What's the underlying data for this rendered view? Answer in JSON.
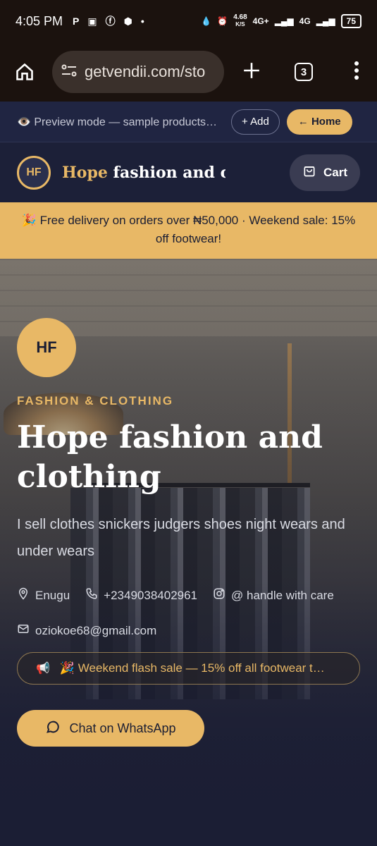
{
  "status_bar": {
    "time": "4:05 PM",
    "net_speed_value": "4.68",
    "net_speed_unit": "K/S",
    "signal_1": "4G+",
    "signal_2": "4G",
    "battery": "75"
  },
  "browser": {
    "url": "getvendii.com/sto",
    "tab_count": "3"
  },
  "preview_bar": {
    "text": "👁️ Preview mode — sample products…",
    "add_label": "+ Add",
    "home_label": "← Home"
  },
  "store_header": {
    "logo_initials": "HF",
    "name_accent": "Hope",
    "name_rest": " fashion and clo",
    "cart_label": "Cart"
  },
  "promo": {
    "text": "🎉 Free delivery on orders over ₦50,000 · Weekend sale: 15% off footwear!"
  },
  "hero": {
    "logo_initials": "HF",
    "category": "FASHION & CLOTHING",
    "title": "Hope fashion and clothing",
    "description": "I sell clothes snickers judgers shoes night wears and under wears",
    "location": "Enugu",
    "phone": "+2349038402961",
    "instagram": "@ handle with care",
    "email": "oziokoe68@gmail.com",
    "flash_text": "🎉 Weekend flash sale — 15% off all footwear t…",
    "whatsapp_label": "Chat on WhatsApp"
  },
  "colors": {
    "accent": "#e8b866",
    "navy": "#1c2038",
    "browser_bg": "#1b120e"
  }
}
